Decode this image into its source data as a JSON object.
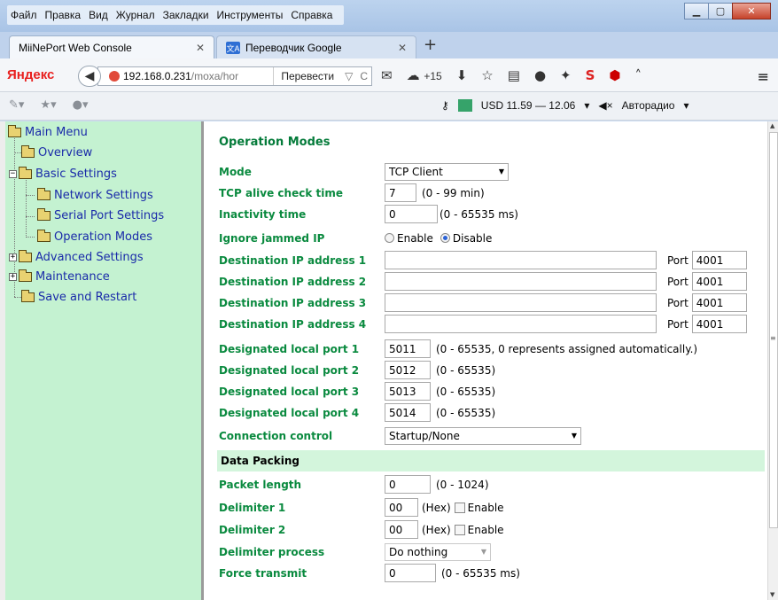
{
  "window": {
    "menu": [
      "Файл",
      "Правка",
      "Вид",
      "Журнал",
      "Закладки",
      "Инструменты",
      "Справка"
    ],
    "controls": {
      "minimize": "▁",
      "maximize": "▢",
      "close": "✕"
    }
  },
  "tabs": [
    {
      "title": "MiiNePort Web Console",
      "active": true,
      "close": "✕"
    },
    {
      "title": "Переводчик Google",
      "active": false,
      "close": "✕",
      "favicon": "文A"
    }
  ],
  "new_tab": "+",
  "nav": {
    "brand": "Яндекс",
    "back": "◀",
    "url_host": "192.168.0.231",
    "url_path": "/moxa/hor",
    "translate": "Перевести",
    "url_dropdown": "▽",
    "reload": "C",
    "weather": "+15",
    "menu_icon": "≡",
    "icons": [
      "mail-icon",
      "weather-icon",
      "download-icon",
      "star-icon",
      "reading-list-icon",
      "chat-icon",
      "ext-icon",
      "s-icon",
      "abp-icon",
      "up-icon"
    ]
  },
  "toolbar": {
    "currency": "USD 11.59 — 12.06",
    "radio": "Авторадио"
  },
  "sidebar": {
    "root": "Main Menu",
    "items": [
      {
        "label": "Overview"
      },
      {
        "label": "Basic Settings",
        "expander": "−"
      },
      {
        "label": "Network Settings"
      },
      {
        "label": "Serial Port Settings"
      },
      {
        "label": "Operation Modes"
      },
      {
        "label": "Advanced Settings",
        "expander": "+"
      },
      {
        "label": "Maintenance",
        "expander": "+"
      },
      {
        "label": "Save and Restart"
      }
    ]
  },
  "form": {
    "section_title": "Operation Modes",
    "mode": {
      "label": "Mode",
      "value": "TCP Client"
    },
    "tcp_alive": {
      "label": "TCP alive check time",
      "value": "7",
      "hint": "(0 - 99 min)"
    },
    "inactivity": {
      "label": "Inactivity time",
      "value": "0",
      "hint": "(0 - 65535 ms)"
    },
    "ignore_jammed": {
      "label": "Ignore jammed IP",
      "enable": "Enable",
      "disable": "Disable",
      "selected": "Disable"
    },
    "dest_ip": [
      {
        "label": "Destination IP address 1",
        "value": "",
        "port_label": "Port",
        "port": "4001"
      },
      {
        "label": "Destination IP address 2",
        "value": "",
        "port_label": "Port",
        "port": "4001"
      },
      {
        "label": "Destination IP address 3",
        "value": "",
        "port_label": "Port",
        "port": "4001"
      },
      {
        "label": "Destination IP address 4",
        "value": "",
        "port_label": "Port",
        "port": "4001"
      }
    ],
    "local_port": [
      {
        "label": "Designated local port 1",
        "value": "5011",
        "hint": "(0 - 65535, 0 represents assigned automatically.)"
      },
      {
        "label": "Designated local port 2",
        "value": "5012",
        "hint": "(0 - 65535)"
      },
      {
        "label": "Designated local port 3",
        "value": "5013",
        "hint": "(0 - 65535)"
      },
      {
        "label": "Designated local port 4",
        "value": "5014",
        "hint": "(0 - 65535)"
      }
    ],
    "connection_control": {
      "label": "Connection control",
      "value": "Startup/None"
    },
    "data_packing_title": "Data Packing",
    "packet_length": {
      "label": "Packet length",
      "value": "0",
      "hint": "(0 - 1024)"
    },
    "delimiter1": {
      "label": "Delimiter 1",
      "value": "00",
      "unit": "(Hex)",
      "enable": "Enable"
    },
    "delimiter2": {
      "label": "Delimiter 2",
      "value": "00",
      "unit": "(Hex)",
      "enable": "Enable"
    },
    "delimiter_process": {
      "label": "Delimiter process",
      "value": "Do nothing"
    },
    "force_transmit": {
      "label": "Force transmit",
      "value": "0",
      "hint": "(0 - 65535 ms)"
    }
  }
}
